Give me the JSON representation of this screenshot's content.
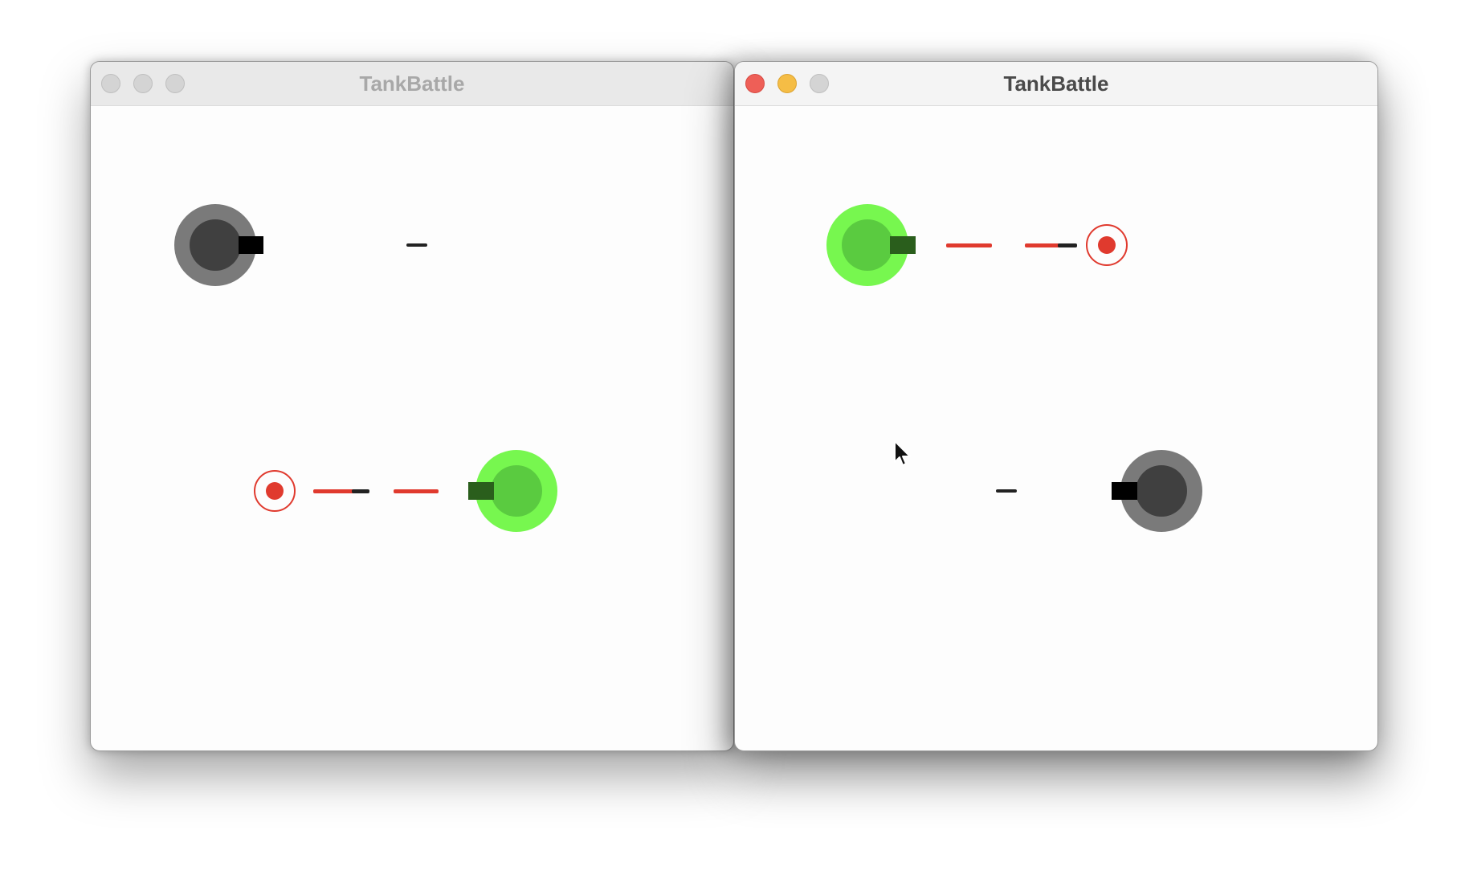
{
  "windows": [
    {
      "id": "left",
      "title": "TankBattle",
      "active": false,
      "player_tank": {
        "body_color": "#77f74f",
        "turret_color": "#5acb40",
        "barrel_color": "#2a5e1c"
      },
      "enemy_tank": {
        "body_color": "#7a7a7a",
        "turret_color": "#404040",
        "barrel_color": "#000000"
      },
      "target": {
        "ring_color": "#e03a2e",
        "dot_color": "#e03a2e"
      },
      "bullet_color": "#e03a2e",
      "enemy_bullet_color": "#222222"
    },
    {
      "id": "right",
      "title": "TankBattle",
      "active": true,
      "player_tank": {
        "body_color": "#77f74f",
        "turret_color": "#5acb40",
        "barrel_color": "#2a5e1c"
      },
      "enemy_tank": {
        "body_color": "#7a7a7a",
        "turret_color": "#404040",
        "barrel_color": "#000000"
      },
      "target": {
        "ring_color": "#e03a2e",
        "dot_color": "#e03a2e"
      },
      "bullet_color": "#e03a2e",
      "enemy_bullet_color": "#222222"
    }
  ],
  "traffic_lights": {
    "close": "close-button",
    "minimize": "minimize-button",
    "zoom": "zoom-button"
  }
}
